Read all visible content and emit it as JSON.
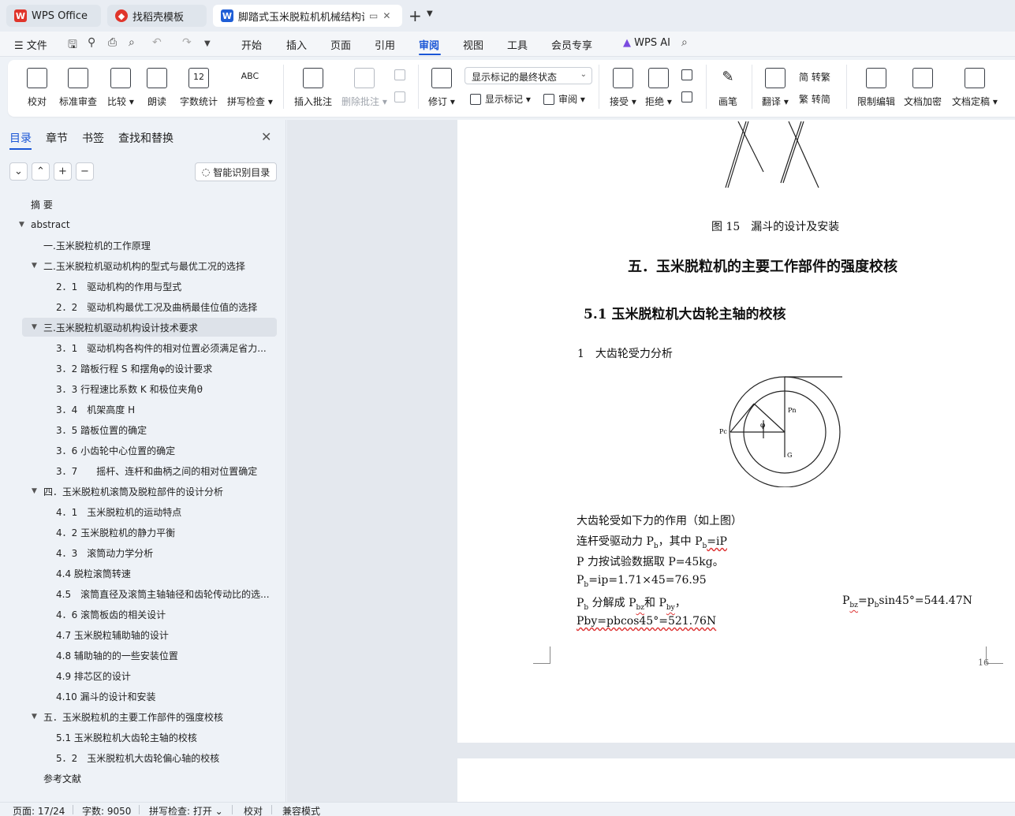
{
  "tabs": [
    {
      "label": "WPS Office",
      "icon": "wps-logo-icon"
    },
    {
      "label": "找稻壳模板",
      "icon": "docer-icon"
    },
    {
      "label": "脚踏式玉米脱粒机机械结构设",
      "icon": "word-doc-icon"
    }
  ],
  "menu": {
    "file": "文件",
    "items": [
      "开始",
      "插入",
      "页面",
      "引用",
      "审阅",
      "视图",
      "工具",
      "会员专享"
    ],
    "active": "审阅",
    "ai": "WPS AI"
  },
  "ribbon": {
    "proofread": "校对",
    "std_review": "标准审查",
    "compare": "比较",
    "read_aloud": "朗读",
    "word_count": "字数统计",
    "spell_check": "拼写检查",
    "insert_comment": "插入批注",
    "delete_comment": "删除批注",
    "track": "修订",
    "markup_state": "显示标记的最终状态",
    "show_markup": "显示标记",
    "review": "审阅",
    "accept": "接受",
    "reject": "拒绝",
    "ink": "画笔",
    "translate": "翻译",
    "to_trad": "简 转繁",
    "to_simp": "繁 转简",
    "restrict": "限制编辑",
    "encrypt": "文档加密",
    "finalize": "文档定稿",
    "word_count_badge": "12"
  },
  "panel": {
    "tabs": [
      "目录",
      "章节",
      "书签",
      "查找和替换"
    ],
    "smart_toc": "智能识别目录",
    "toc": [
      {
        "text": "摘 要",
        "level": 0
      },
      {
        "text": "abstract",
        "level": 0
      },
      {
        "text": "一.玉米脱粒机的工作原理",
        "level": 1
      },
      {
        "text": "二.玉米脱粒机驱动机构的型式与最优工况的选择",
        "level": 1
      },
      {
        "text": "2．1　驱动机构的作用与型式",
        "level": 2
      },
      {
        "text": "2．2　驱动机构最优工况及曲柄最佳位值的选择",
        "level": 2
      },
      {
        "text": "三.玉米脱粒机驱动机构设计技术要求",
        "level": 1
      },
      {
        "text": "3．1　驱动机构各构件的相对位置必须满足省力...",
        "level": 2
      },
      {
        "text": "3．2 踏板行程 S 和摆角φ的设计要求",
        "level": 2
      },
      {
        "text": "3．3 行程速比系数 K 和极位夹角θ",
        "level": 2
      },
      {
        "text": "3．4　机架高度 H",
        "level": 2
      },
      {
        "text": "3．5 踏板位置的确定",
        "level": 2
      },
      {
        "text": "3．6 小齿轮中心位置的确定",
        "level": 2
      },
      {
        "text": "3．7　　摇杆、连杆和曲柄之间的相对位置确定",
        "level": 2
      },
      {
        "text": "四．玉米脱粒机滚筒及脱粒部件的设计分析",
        "level": 1
      },
      {
        "text": "4．1　玉米脱粒机的运动特点",
        "level": 2
      },
      {
        "text": "4．2 玉米脱粒机的静力平衡",
        "level": 2
      },
      {
        "text": "4．3　滚筒动力学分析",
        "level": 2
      },
      {
        "text": "4.4 脱粒滚筒转速",
        "level": 2
      },
      {
        "text": "4.5　滚筒直径及滚筒主轴轴径和齿轮传动比的选...",
        "level": 2
      },
      {
        "text": "4．6 滚筒板齿的相关设计",
        "level": 2
      },
      {
        "text": "4.7 玉米脱粒辅助轴的设计",
        "level": 2
      },
      {
        "text": "4.8 辅助轴的的一些安装位置",
        "level": 2
      },
      {
        "text": "4.9 排芯区的设计",
        "level": 2
      },
      {
        "text": "4.10 漏斗的设计和安装",
        "level": 2
      },
      {
        "text": "五．玉米脱粒机的主要工作部件的强度校核",
        "level": 1
      },
      {
        "text": "5.1 玉米脱粒机大齿轮主轴的校核",
        "level": 2
      },
      {
        "text": "5．2　玉米脱粒机大齿轮偏心轴的校核",
        "level": 2
      },
      {
        "text": "参考文献",
        "level": 1
      }
    ]
  },
  "doc": {
    "fig_caption": "图 15　漏斗的设计及安装",
    "h1": "五．玉米脱粒机的主要工作部件的强度校核",
    "h2": "5.1  玉米脱粒机大齿轮主轴的校核",
    "p_title": "1　大齿轮受力分析",
    "diagram_labels": {
      "pn": "Pn",
      "pc": "Pc",
      "phi": "φ",
      "g": "G"
    },
    "l1": "大齿轮受如下力的作用（如上图）",
    "l2a": "连杆受驱动力 P",
    "l2b": "b",
    "l2c": "，其中 P",
    "l2d": "b",
    "l2e": "=iP",
    "l3": "P 力按试验数据取 P=45kg。",
    "l4a": "P",
    "l4b": "b",
    "l4c": "=ip=1.71×45=76.95",
    "l5a": "P",
    "l5b": "b",
    "l5c": " 分解成 P",
    "l5d": "bz",
    "l5e": "和 P",
    "l5f": "by",
    "l5g": "，",
    "l5h": "P",
    "l5i": "bz",
    "l5j": "=p",
    "l5k": "b",
    "l5l": "sin45°=544.47N",
    "l6": "Pby=pbcos45°=521.76N",
    "page_num": "16"
  },
  "status": {
    "page": "页面: 17/24",
    "words": "字数: 9050",
    "spell": "拼写检查: 打开",
    "proof": "校对",
    "compat": "兼容模式"
  },
  "colors": {
    "accent": "#1a56d6",
    "wps_red": "#e0352b"
  }
}
